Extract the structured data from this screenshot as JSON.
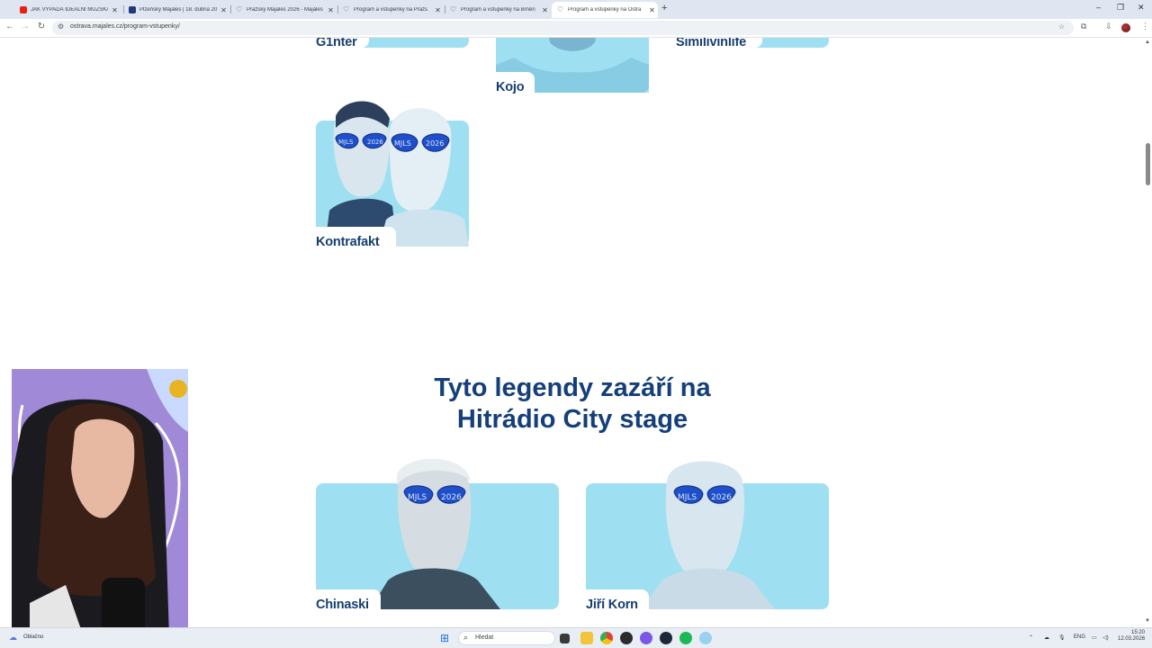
{
  "browser": {
    "tabs": [
      {
        "title": "JAK VYPADÁ IDEÁLNÍ MUŽSKÁ",
        "favicon_color": "#e62117",
        "active": false
      },
      {
        "title": "Plzeňský Majáles | 18. dubna 20",
        "favicon_color": "#1e3a78",
        "active": false
      },
      {
        "title": "Pražský Majáles 2026 - Majáles",
        "favicon_color": "#3a4f7a",
        "active": false
      },
      {
        "title": "Program a vstupenky na Pražs",
        "favicon_color": "#3a4f7a",
        "active": false
      },
      {
        "title": "Program a vstupenky na Brněn",
        "favicon_color": "#3a4f7a",
        "active": false
      },
      {
        "title": "Program a vstupenky na Ostra",
        "favicon_color": "#3a4f7a",
        "active": true
      }
    ],
    "url": "ostrava.majales.cz/program-vstupenky/"
  },
  "page": {
    "artists_top": [
      {
        "name": "G1nter"
      },
      {
        "name": "Kojo"
      },
      {
        "name": "Similivinlife"
      },
      {
        "name": "Kontrafakt"
      }
    ],
    "stage_heading_line1": "Tyto legendy zazáří na",
    "stage_heading_line2": "Hitrádio City stage",
    "artists_legends": [
      {
        "name": "Chinaski"
      },
      {
        "name": "Jiří Korn"
      }
    ],
    "glasses_text": "MJLS 2026",
    "accent_color": "#9ee0f1",
    "heading_color": "#143f7a"
  },
  "taskbar": {
    "weather": "Oblačno",
    "search_placeholder": "Hledat",
    "language": "ENG",
    "time": "15:20",
    "date": "12.03.2026"
  }
}
